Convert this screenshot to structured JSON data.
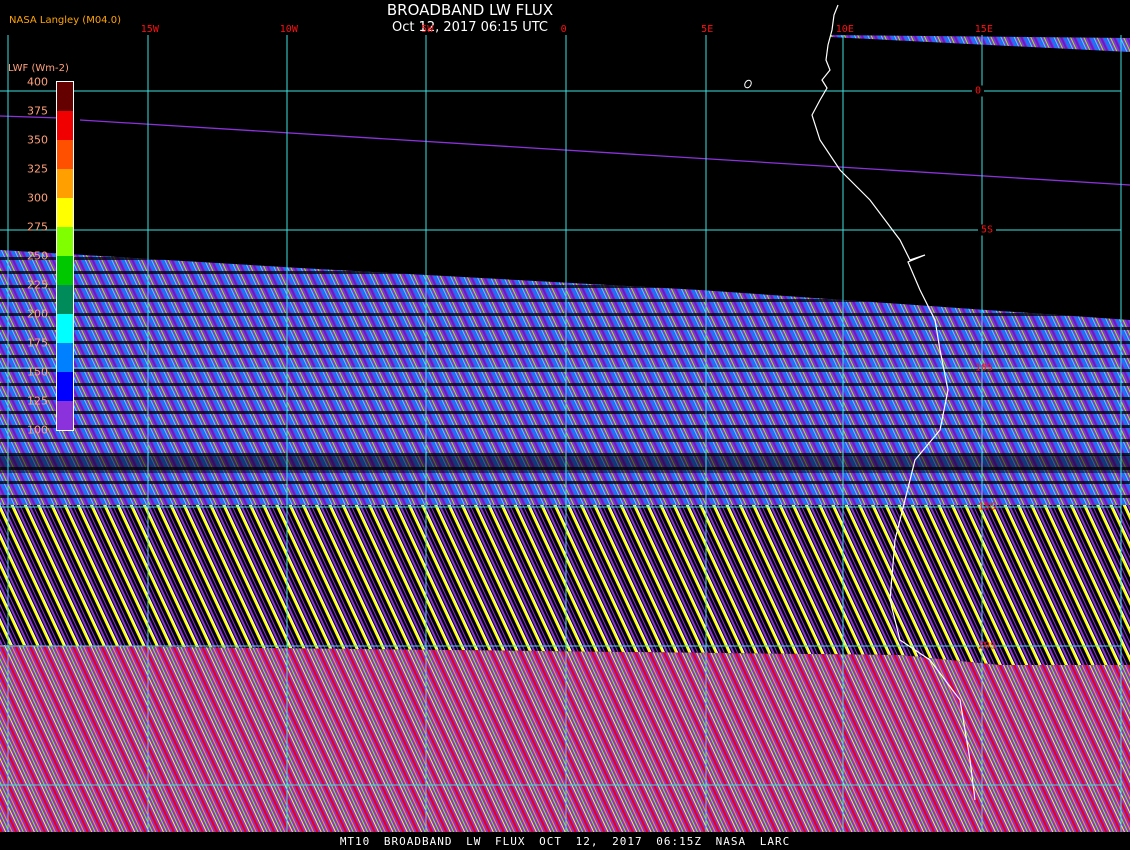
{
  "header": {
    "title": "BROADBAND LW FLUX",
    "datetime": "Oct 12, 2017 06:15 UTC",
    "source": "NASA Langley (M04.0)"
  },
  "map": {
    "longitude_labels": [
      "15W",
      "10W",
      "5W",
      "0",
      "5E",
      "10E",
      "15E"
    ],
    "latitude_labels": [
      "0",
      "5S",
      "10S",
      "15S",
      "20S"
    ]
  },
  "colorbar": {
    "title": "LWF (Wm-2)",
    "labels": [
      "400",
      "375",
      "350",
      "325",
      "300",
      "275",
      "250",
      "225",
      "200",
      "175",
      "150",
      "125",
      "100"
    ],
    "colors": [
      "#640000",
      "#f00000",
      "#ff5000",
      "#ffa000",
      "#ffff00",
      "#80ff00",
      "#00c800",
      "#008c5a",
      "#00ffff",
      "#0080ff",
      "#0000ff",
      "#8c32dc"
    ]
  },
  "footer": {
    "text": "MT10  BROADBAND LW FLUX   OCT 12, 2017 06:15Z   NASA LARC"
  }
}
